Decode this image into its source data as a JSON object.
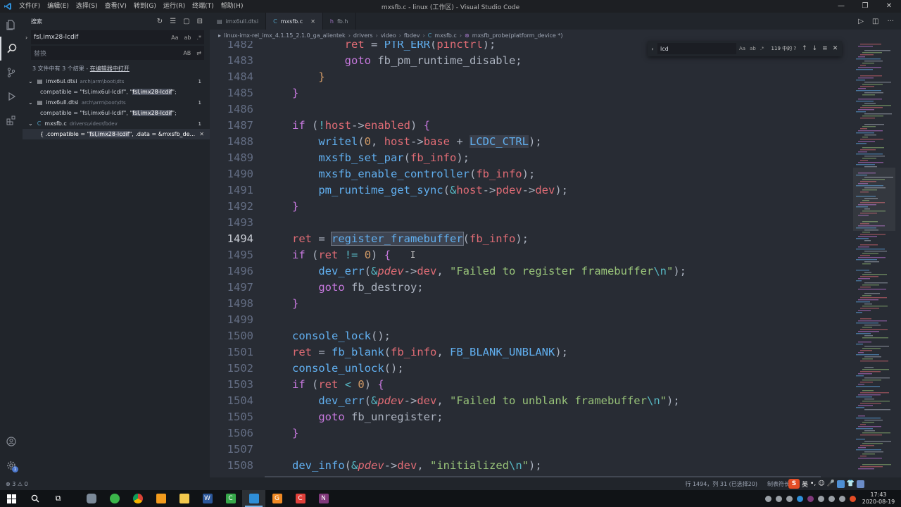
{
  "titlebar": {
    "menus": [
      "文件(F)",
      "编辑(E)",
      "选择(S)",
      "查看(V)",
      "转到(G)",
      "运行(R)",
      "终端(T)",
      "帮助(H)"
    ],
    "title": "mxsfb.c - linux (工作区) - Visual Studio Code"
  },
  "activity": {
    "settings_badge": "1"
  },
  "sidebar": {
    "header": "搜索",
    "search_value": "fsl,imx28-lcdif",
    "search_opts": [
      "Aa",
      "ab",
      ".*"
    ],
    "replace_placeholder": "替换",
    "replace_opt": "AB",
    "summary": "3 文件中有 3 个结果 - ",
    "summary_link": "在编辑器中打开",
    "results": [
      {
        "file": "imx6ul.dtsi",
        "path": "arch\\arm\\boot\\dts",
        "count": "1",
        "line_pre": "compatible = \"fsl,imx6ul-lcdif\", \"",
        "line_hl": "fsl,imx28-lcdif",
        "line_post": "\";"
      },
      {
        "file": "imx6ull.dtsi",
        "path": "arch\\arm\\boot\\dts",
        "count": "1",
        "line_pre": "compatible = \"fsl,imx6ul-lcdif\", \"",
        "line_hl": "fsl,imx28-lcdif",
        "line_post": "\";"
      },
      {
        "file": "mxsfb.c",
        "path": "drivers\\video\\fbdev",
        "count": "1",
        "line_pre": "{ .compatible = \"",
        "line_hl": "fsl,imx28-lcdif",
        "line_post": "\", .data = &mxsfb_de..."
      }
    ]
  },
  "tabs": [
    {
      "label": "imx6ull.dtsi",
      "active": false
    },
    {
      "label": "mxsfb.c",
      "active": true
    },
    {
      "label": "fb.h",
      "active": false
    }
  ],
  "breadcrumb": [
    "linux-imx-rel_imx_4.1.15_2.1.0_ga_alientek",
    "drivers",
    "video",
    "fbdev",
    "mxsfb.c",
    "mxsfb_probe(platform_device *)"
  ],
  "find": {
    "value": "lcd",
    "opts": [
      "Aa",
      "ab",
      ".*"
    ],
    "count": "119 中的 ?"
  },
  "editor": {
    "current_line": "1494",
    "lines": [
      {
        "n": "1482",
        "t": [
          [
            "",
            "        "
          ],
          [
            "v",
            "ret"
          ],
          [
            "p",
            " = "
          ],
          [
            "f",
            "PTR_ERR"
          ],
          [
            "p",
            "("
          ],
          [
            "v",
            "pinctrl"
          ],
          [
            "p",
            ");"
          ]
        ]
      },
      {
        "n": "1483",
        "t": [
          [
            "",
            "        "
          ],
          [
            "k",
            "goto"
          ],
          [
            "p",
            " fb_pm_runtime_disable;"
          ]
        ]
      },
      {
        "n": "1484",
        "t": [
          [
            "",
            "    "
          ],
          [
            "n",
            "}"
          ]
        ]
      },
      {
        "n": "1485",
        "t": [
          [
            "k",
            "}"
          ]
        ]
      },
      {
        "n": "1486",
        "t": []
      },
      {
        "n": "1487",
        "t": [
          [
            "k",
            "if"
          ],
          [
            "p",
            " ("
          ],
          [
            "o",
            "!"
          ],
          [
            "v",
            "host"
          ],
          [
            "p",
            "->"
          ],
          [
            "v",
            "enabled"
          ],
          [
            "p",
            ") "
          ],
          [
            "k",
            "{"
          ]
        ]
      },
      {
        "n": "1488",
        "t": [
          [
            "",
            "    "
          ],
          [
            "f",
            "writel"
          ],
          [
            "p",
            "("
          ],
          [
            "n",
            "0"
          ],
          [
            "p",
            ", "
          ],
          [
            "v",
            "host"
          ],
          [
            "p",
            "->"
          ],
          [
            "v",
            "base"
          ],
          [
            "p",
            " + "
          ],
          [
            "lcdc",
            "LCDC_CTRL"
          ],
          [
            "p",
            ");"
          ]
        ]
      },
      {
        "n": "1489",
        "t": [
          [
            "",
            "    "
          ],
          [
            "f",
            "mxsfb_set_par"
          ],
          [
            "p",
            "("
          ],
          [
            "v",
            "fb_info"
          ],
          [
            "p",
            ");"
          ]
        ]
      },
      {
        "n": "1490",
        "t": [
          [
            "",
            "    "
          ],
          [
            "f",
            "mxsfb_enable_controller"
          ],
          [
            "p",
            "("
          ],
          [
            "v",
            "fb_info"
          ],
          [
            "p",
            ");"
          ]
        ]
      },
      {
        "n": "1491",
        "t": [
          [
            "",
            "    "
          ],
          [
            "f",
            "pm_runtime_get_sync"
          ],
          [
            "p",
            "("
          ],
          [
            "o",
            "&"
          ],
          [
            "v",
            "host"
          ],
          [
            "p",
            "->"
          ],
          [
            "v",
            "pdev"
          ],
          [
            "p",
            "->"
          ],
          [
            "v",
            "dev"
          ],
          [
            "p",
            ");"
          ]
        ]
      },
      {
        "n": "1492",
        "t": [
          [
            "k",
            "}"
          ]
        ]
      },
      {
        "n": "1493",
        "t": []
      },
      {
        "n": "1494",
        "t": [
          [
            "v",
            "ret"
          ],
          [
            "p",
            " = "
          ],
          [
            "reg",
            "register_framebuffer"
          ],
          [
            "p",
            "("
          ],
          [
            "v",
            "fb_info"
          ],
          [
            "p",
            ");"
          ]
        ]
      },
      {
        "n": "1495",
        "t": [
          [
            "k",
            "if"
          ],
          [
            "p",
            " ("
          ],
          [
            "v",
            "ret"
          ],
          [
            "p",
            " "
          ],
          [
            "o",
            "!="
          ],
          [
            "p",
            " "
          ],
          [
            "n",
            "0"
          ],
          [
            "p",
            ") "
          ],
          [
            "k",
            "{"
          ]
        ]
      },
      {
        "n": "1496",
        "t": [
          [
            "",
            "    "
          ],
          [
            "f",
            "dev_err"
          ],
          [
            "p",
            "("
          ],
          [
            "o",
            "&"
          ],
          [
            "i",
            "pdev"
          ],
          [
            "p",
            "->"
          ],
          [
            "v",
            "dev"
          ],
          [
            "p",
            ", "
          ],
          [
            "s",
            "\"Failed to register framebuffer"
          ],
          [
            "o",
            "\\n"
          ],
          [
            "s",
            "\""
          ],
          [
            "p",
            ");"
          ]
        ]
      },
      {
        "n": "1497",
        "t": [
          [
            "",
            "    "
          ],
          [
            "k",
            "goto"
          ],
          [
            "p",
            " fb_destroy;"
          ]
        ]
      },
      {
        "n": "1498",
        "t": [
          [
            "k",
            "}"
          ]
        ]
      },
      {
        "n": "1499",
        "t": []
      },
      {
        "n": "1500",
        "t": [
          [
            "f",
            "console_lock"
          ],
          [
            "p",
            "();"
          ]
        ]
      },
      {
        "n": "1501",
        "t": [
          [
            "v",
            "ret"
          ],
          [
            "p",
            " = "
          ],
          [
            "f",
            "fb_blank"
          ],
          [
            "p",
            "("
          ],
          [
            "v",
            "fb_info"
          ],
          [
            "p",
            ", "
          ],
          [
            "f",
            "FB_BLANK_UNBLANK"
          ],
          [
            "p",
            ");"
          ]
        ]
      },
      {
        "n": "1502",
        "t": [
          [
            "f",
            "console_unlock"
          ],
          [
            "p",
            "();"
          ]
        ]
      },
      {
        "n": "1503",
        "t": [
          [
            "k",
            "if"
          ],
          [
            "p",
            " ("
          ],
          [
            "v",
            "ret"
          ],
          [
            "p",
            " "
          ],
          [
            "o",
            "<"
          ],
          [
            "p",
            " "
          ],
          [
            "n",
            "0"
          ],
          [
            "p",
            ") "
          ],
          [
            "k",
            "{"
          ]
        ]
      },
      {
        "n": "1504",
        "t": [
          [
            "",
            "    "
          ],
          [
            "f",
            "dev_err"
          ],
          [
            "p",
            "("
          ],
          [
            "o",
            "&"
          ],
          [
            "i",
            "pdev"
          ],
          [
            "p",
            "->"
          ],
          [
            "v",
            "dev"
          ],
          [
            "p",
            ", "
          ],
          [
            "s",
            "\"Failed to unblank framebuffer"
          ],
          [
            "o",
            "\\n"
          ],
          [
            "s",
            "\""
          ],
          [
            "p",
            ");"
          ]
        ]
      },
      {
        "n": "1505",
        "t": [
          [
            "",
            "    "
          ],
          [
            "k",
            "goto"
          ],
          [
            "p",
            " fb_unregister;"
          ]
        ]
      },
      {
        "n": "1506",
        "t": [
          [
            "k",
            "}"
          ]
        ]
      },
      {
        "n": "1507",
        "t": []
      },
      {
        "n": "1508",
        "t": [
          [
            "f",
            "dev_info"
          ],
          [
            "p",
            "("
          ],
          [
            "o",
            "&"
          ],
          [
            "i",
            "pdev"
          ],
          [
            "p",
            "->"
          ],
          [
            "v",
            "dev"
          ],
          [
            "p",
            ", "
          ],
          [
            "s",
            "\"initialized"
          ],
          [
            "o",
            "\\n"
          ],
          [
            "s",
            "\""
          ],
          [
            "p",
            ");"
          ]
        ]
      }
    ]
  },
  "status": {
    "problems": "⊗ 3 ⚠ 0",
    "position": "行 1494，列 31 (已选择20)",
    "indent": "制表符长度"
  },
  "ime": {
    "mode": "英"
  },
  "taskbar": {
    "time": "17:43",
    "date": "2020-08-19"
  },
  "colors": {
    "accent": "#528bff",
    "editor_bg": "#282c34",
    "sidebar_bg": "#21252b"
  }
}
